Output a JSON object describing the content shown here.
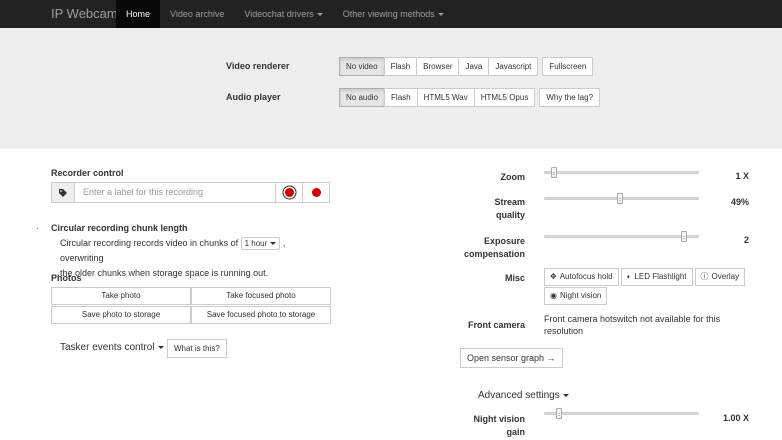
{
  "navbar": {
    "brand": "IP Webcam",
    "items": [
      {
        "label": "Home",
        "active": true,
        "dropdown": false
      },
      {
        "label": "Video archive",
        "active": false,
        "dropdown": false
      },
      {
        "label": "Videochat drivers",
        "active": false,
        "dropdown": true
      },
      {
        "label": "Other viewing methods",
        "active": false,
        "dropdown": true
      }
    ]
  },
  "renderer": {
    "video_label": "Video renderer",
    "video_options": [
      "No video",
      "Flash",
      "Browser",
      "Java",
      "Javascript"
    ],
    "video_fullscreen": "Fullscreen",
    "audio_label": "Audio player",
    "audio_options": [
      "No audio",
      "Flash",
      "HTML5 Wav",
      "HTML5 Opus"
    ],
    "audio_help": "Why the lag?"
  },
  "recorder": {
    "title": "Recorder control",
    "placeholder": "Enter a label for this recording"
  },
  "chunk": {
    "title": "Circular recording chunk length",
    "text_before": "Circular recording records video in chunks of",
    "select_value": "1 hour",
    "text_after": ", overwriting",
    "text_line2": "the older chunks when storage space is running out."
  },
  "photos": {
    "title": "Photos",
    "buttons": [
      "Take photo",
      "Take focused photo",
      "Save photo to storage",
      "Save focused photo to storage"
    ]
  },
  "tasker": {
    "label": "Tasker events control",
    "help": "What is this?"
  },
  "controls": {
    "zoom": {
      "label": "Zoom",
      "value": "1 X",
      "fraction": 0.05
    },
    "quality": {
      "label1": "Stream",
      "label2": "quality",
      "value": "49%",
      "fraction": 0.49
    },
    "exposure": {
      "label1": "Exposure",
      "label2": "compensation",
      "value": "2",
      "fraction": 0.92
    },
    "misc": {
      "label": "Misc",
      "buttons": [
        "Autofocus hold",
        "LED Flashlight",
        "Overlay",
        "Night vision"
      ]
    },
    "front_camera": {
      "label": "Front camera",
      "text1": "Front camera hotswitch not available for this",
      "text2": "resolution"
    },
    "sensor_graph": "Open sensor graph →",
    "advanced": "Advanced settings",
    "night_gain": {
      "label1": "Night vision",
      "label2": "gain",
      "value": "1.00 X",
      "fraction": 0.08
    }
  }
}
